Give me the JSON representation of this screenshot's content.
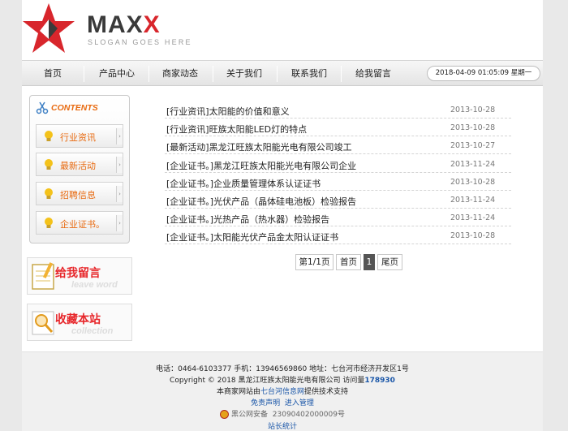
{
  "logo": {
    "brand_main": "MAX",
    "brand_accent": "X",
    "slogan": "SLOGAN GOES HERE"
  },
  "nav": {
    "items": [
      "首页",
      "产品中心",
      "商家动态",
      "关于我们",
      "联系我们",
      "给我留言"
    ],
    "datetime": "2018-04-09 01:05:09 星期一"
  },
  "sidebar": {
    "title": "CONTENTS",
    "items": [
      "行业资讯",
      "最新活动",
      "招聘信息",
      "企业证书。"
    ]
  },
  "promos": {
    "message": {
      "title": "给我留言",
      "subtitle": "leave word"
    },
    "bookmark": {
      "title": "收藏本站",
      "subtitle": "collection"
    }
  },
  "news": [
    {
      "title": "[行业资讯]太阳能的价值和意义",
      "date": "2013-10-28"
    },
    {
      "title": "[行业资讯]旺族太阳能LED灯的特点",
      "date": "2013-10-28"
    },
    {
      "title": "[最新活动]黑龙江旺族太阳能光电有限公司竣工",
      "date": "2013-10-27"
    },
    {
      "title": "[企业证书。]黑龙江旺族太阳能光电有限公司企业",
      "date": "2013-11-24"
    },
    {
      "title": "[企业证书。]企业质量管理体系认证证书",
      "date": "2013-10-28"
    },
    {
      "title": "[企业证书。]光伏产品（晶体硅电池板）检验报告",
      "date": "2013-11-24"
    },
    {
      "title": "[企业证书。]光热产品（热水器）检验报告",
      "date": "2013-11-24"
    },
    {
      "title": "[企业证书。]太阳能光伏产品金太阳认证证书",
      "date": "2013-10-28"
    }
  ],
  "pager": {
    "info": "第1/1页",
    "first": "首页",
    "current": "1",
    "last": "尾页"
  },
  "footer": {
    "contact": "电话：0464-6103377  手机：13946569860  地址：七台河市经济开发区1号",
    "copyright_prefix": "Copyright © 2018 黑龙江旺族太阳能光电有限公司 访问量",
    "visits": "178930",
    "support_prefix": "本商家网站由",
    "support_link": "七台河信息网",
    "support_suffix": "提供技术支持",
    "disclaimer": "免责声明",
    "admin": "进入管理",
    "icp_label": "黑公网安备",
    "icp_number": "23090402000009号",
    "stats": "站长统计"
  }
}
